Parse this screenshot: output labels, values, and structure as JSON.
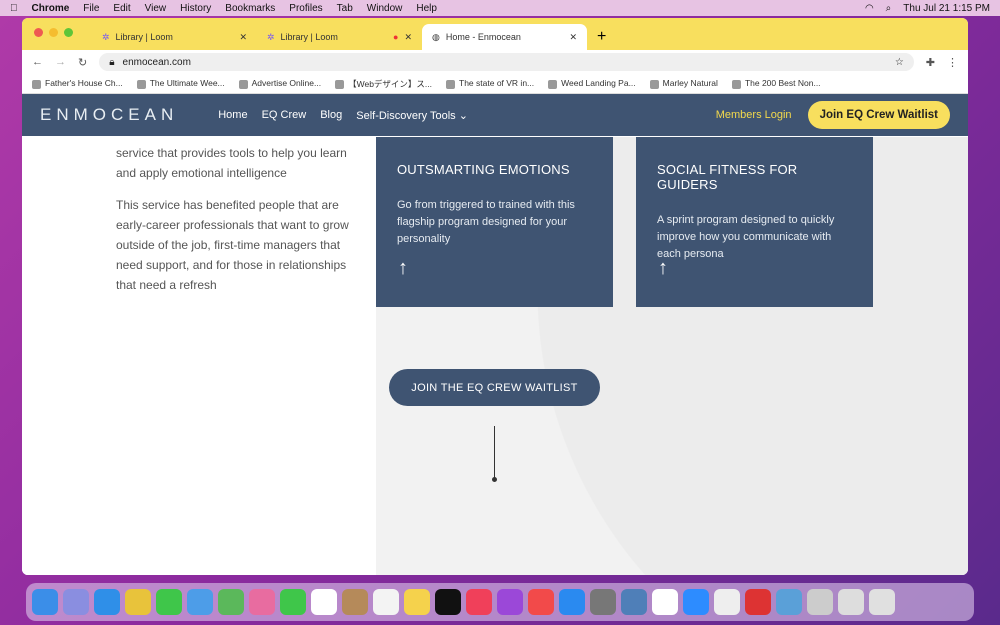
{
  "menubar": {
    "app": "Chrome",
    "items": [
      "File",
      "Edit",
      "View",
      "History",
      "Bookmarks",
      "Profiles",
      "Tab",
      "Window",
      "Help"
    ],
    "clock": "Thu Jul 21  1:15 PM"
  },
  "tabs": [
    {
      "label": "Library | Loom"
    },
    {
      "label": "Library | Loom"
    },
    {
      "label": "Home - Enmocean"
    }
  ],
  "address": {
    "url": "enmocean.com"
  },
  "bookmarks": [
    "Father's House Ch...",
    "The Ultimate Wee...",
    "Advertise Online...",
    "【Webデザイン】ス...",
    "The state of VR in...",
    "Weed Landing Pa...",
    "Marley Natural",
    "The 200 Best Non..."
  ],
  "site": {
    "logo": "ENMOCEAN",
    "nav": [
      "Home",
      "EQ Crew",
      "Blog",
      "Self-Discovery Tools ⌄"
    ],
    "members_login": "Members Login",
    "join_button": "Join EQ Crew Waitlist",
    "intro": [
      "service that provides tools to help you learn and apply emotional intelligence",
      "This service has benefited people that are early-career professionals that want to grow outside of the job, first-time managers that need support, and for those in relationships that need a refresh"
    ],
    "cards": [
      {
        "title": "OUTSMARTING EMOTIONS",
        "desc": "Go from triggered to trained with this flagship program designed for your personality",
        "arrow": "↑"
      },
      {
        "title": "SOCIAL FITNESS FOR GUIDERS",
        "desc": "A sprint program designed to quickly improve how you communicate with each persona",
        "arrow": "↑"
      }
    ],
    "cta": "JOIN THE EQ CREW WAITLIST"
  },
  "colors": {
    "brand": "#3f5472",
    "accent": "#f8df5e"
  }
}
